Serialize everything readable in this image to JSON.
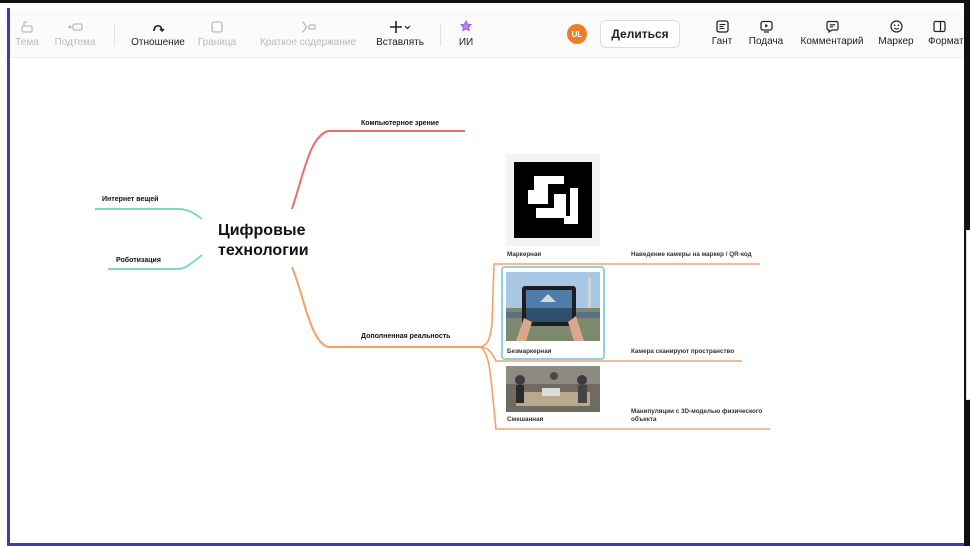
{
  "toolbar": {
    "tools": [
      {
        "label": "Тема",
        "icon": "topic-icon",
        "enabled": false
      },
      {
        "label": "Подтема",
        "icon": "subtopic-icon",
        "enabled": false
      },
      {
        "label": "Отношение",
        "icon": "relationship-icon",
        "enabled": true
      },
      {
        "label": "Граница",
        "icon": "boundary-icon",
        "enabled": false
      },
      {
        "label": "Краткое содержание",
        "icon": "summary-icon",
        "enabled": false
      },
      {
        "label": "Вставлять",
        "icon": "insert-icon",
        "enabled": true
      },
      {
        "label": "ИИ",
        "icon": "ai-icon",
        "enabled": true
      }
    ],
    "avatar_initials": "UL",
    "share_label": "Делиться",
    "right_tools": [
      {
        "label": "Гант",
        "icon": "gantt-icon"
      },
      {
        "label": "Подача",
        "icon": "pitch-icon"
      },
      {
        "label": "Комментарий",
        "icon": "comment-icon"
      },
      {
        "label": "Маркер",
        "icon": "marker-icon"
      },
      {
        "label": "Формат",
        "icon": "format-icon"
      }
    ]
  },
  "mindmap": {
    "central": "Цифровые технологии",
    "central_lines": [
      "Цифровые",
      "технологии"
    ],
    "branches": {
      "computer_vision": "Компьютерное зрение",
      "iot": "Интернет вещей",
      "robotics": "Роботизация",
      "ar": "Дополненная реальность"
    },
    "ar_children": [
      {
        "label": "Маркерная",
        "note": "Наведение камеры на маркер / QR-код"
      },
      {
        "label": "Безмаркерная",
        "note": "Камера сканируют пространство"
      },
      {
        "label": "Смешанная",
        "note": "Манипуляции с 3D-моделью физического объекта"
      }
    ],
    "note_line1": "Манипуляции с 3D-моделью физического",
    "note_line2": "объекта"
  },
  "colors": {
    "accent_frame": "#3b3fb3",
    "red_branch": "#ef6b6b",
    "orange_branch": "#f5a06b",
    "teal_branch": "#7fd8c4",
    "avatar": "#f07c2a",
    "ai_purple": "#9a5ae0",
    "selection": "#8fd0ea"
  }
}
